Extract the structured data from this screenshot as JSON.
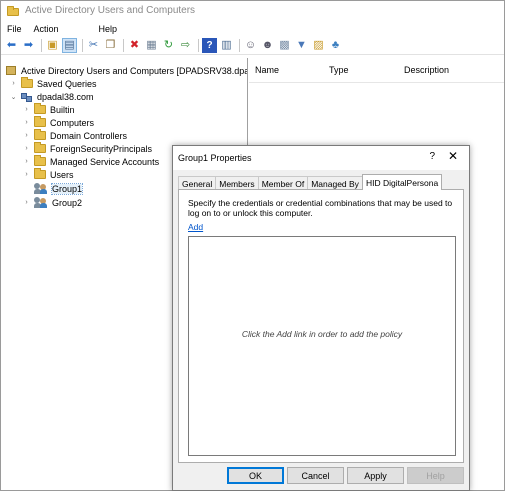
{
  "app": {
    "title": "Active Directory Users and Computers"
  },
  "menu": {
    "items": [
      "File",
      "Action",
      "Help"
    ]
  },
  "tree": {
    "root": "Active Directory Users and Computers [DPADSRV38.dpada",
    "saved_queries": "Saved Queries",
    "domain": "dpadal38.com",
    "children": [
      "Builtin",
      "Computers",
      "Domain Controllers",
      "ForeignSecurityPrincipals",
      "Managed Service Accounts",
      "Users",
      "Group1",
      "Group2"
    ]
  },
  "list": {
    "columns": [
      "Name",
      "Type",
      "Description"
    ]
  },
  "dialog": {
    "title": "Group1 Properties",
    "help": "?",
    "close": "✕",
    "tabs": [
      "General",
      "Members",
      "Member Of",
      "Managed By",
      "HID DigitalPersona"
    ],
    "active_tab": "HID DigitalPersona",
    "description": "Specify the credentials or credential combinations that may be used to log on to or unlock this computer.",
    "add_link": "Add",
    "hint": "Click the Add link in order to add the policy",
    "buttons": {
      "ok": "OK",
      "cancel": "Cancel",
      "apply": "Apply",
      "help": "Help"
    }
  },
  "colors": {
    "link": "#0055cc",
    "folder": "#e8c04a",
    "primary_border": "#0078d7"
  }
}
